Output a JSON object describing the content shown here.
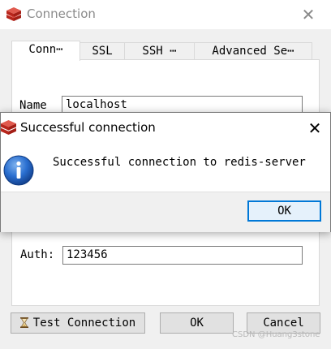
{
  "window": {
    "title": "Connection",
    "close_glyph": "✕"
  },
  "tabs": [
    {
      "label": "Conn⋯"
    },
    {
      "label": "SSL"
    },
    {
      "label": "SSH ⋯"
    },
    {
      "label": "Advanced Se⋯"
    }
  ],
  "form": {
    "name_label": "Name",
    "name_value": "localhost",
    "auth_label": "Auth:",
    "auth_value": "123456"
  },
  "buttons": {
    "test_connection": "Test Connection",
    "ok": "OK",
    "cancel": "Cancel"
  },
  "dialog": {
    "title": "Successful connection",
    "close_glyph": "✕",
    "message": "Successful connection to redis-server",
    "ok_label": "OK"
  },
  "watermark": "CSDN @Huang3stone",
  "colors": {
    "brand_red": "#d82c20",
    "info_blue": "#1f5fbf",
    "focus_blue": "#0078d7"
  },
  "icons": {
    "app": "redis-logo-icon",
    "dialog": "info-icon",
    "test": "hourglass-icon"
  }
}
